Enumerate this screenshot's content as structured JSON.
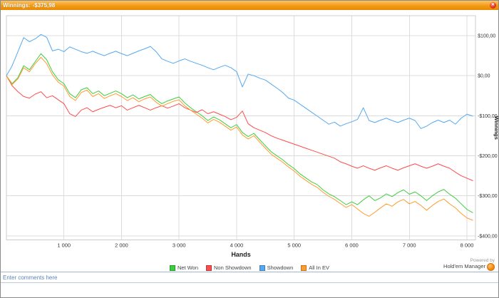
{
  "window": {
    "title_label": "Winnings:",
    "title_value": "-$375,98",
    "close_glyph": "✕"
  },
  "chart_data": {
    "type": "line",
    "title": "",
    "xlabel": "Hands",
    "ylabel": "Winnings",
    "xlim": [
      0,
      8150
    ],
    "ylim": [
      -410,
      150
    ],
    "grid": true,
    "legend_position": "bottom",
    "x_start": 0,
    "x_step": 100,
    "x_ticks": [
      1000,
      2000,
      3000,
      4000,
      5000,
      6000,
      7000,
      8000
    ],
    "x_tick_labels": [
      "1 000",
      "2 000",
      "3 000",
      "4 000",
      "5 000",
      "6 000",
      "7 000",
      "8 000"
    ],
    "y_ticks": [
      100,
      0,
      -100,
      -200,
      -300,
      -400
    ],
    "y_tick_labels": [
      "$100,00",
      "$0,00",
      "-$100,00",
      "-$200,00",
      "-$300,00",
      "-$400,00"
    ],
    "series": [
      {
        "name": "Net Won",
        "color": "#3ecc3e",
        "values": [
          0,
          -20,
          -5,
          25,
          15,
          35,
          55,
          40,
          10,
          -10,
          -20,
          -45,
          -55,
          -35,
          -30,
          -45,
          -38,
          -50,
          -44,
          -38,
          -45,
          -55,
          -48,
          -58,
          -52,
          -47,
          -60,
          -70,
          -63,
          -58,
          -53,
          -68,
          -80,
          -90,
          -100,
          -112,
          -103,
          -110,
          -120,
          -130,
          -122,
          -142,
          -152,
          -144,
          -160,
          -175,
          -190,
          -200,
          -210,
          -222,
          -232,
          -245,
          -255,
          -265,
          -272,
          -285,
          -295,
          -302,
          -312,
          -322,
          -315,
          -322,
          -310,
          -300,
          -312,
          -305,
          -295,
          -302,
          -292,
          -285,
          -296,
          -290,
          -300,
          -312,
          -300,
          -290,
          -284,
          -296,
          -306,
          -320,
          -334,
          -342
        ]
      },
      {
        "name": "Non Showdown",
        "color": "#ff4b4b",
        "values": [
          0,
          -25,
          -40,
          -52,
          -56,
          -46,
          -40,
          -55,
          -50,
          -60,
          -70,
          -95,
          -102,
          -86,
          -80,
          -90,
          -84,
          -79,
          -74,
          -80,
          -75,
          -86,
          -80,
          -74,
          -80,
          -86,
          -80,
          -75,
          -81,
          -76,
          -70,
          -80,
          -86,
          -92,
          -85,
          -95,
          -90,
          -96,
          -102,
          -110,
          -104,
          -88,
          -120,
          -130,
          -136,
          -142,
          -150,
          -156,
          -161,
          -166,
          -171,
          -176,
          -181,
          -186,
          -191,
          -196,
          -201,
          -206,
          -215,
          -220,
          -226,
          -231,
          -225,
          -231,
          -236,
          -230,
          -225,
          -231,
          -236,
          -230,
          -225,
          -220,
          -226,
          -231,
          -226,
          -220,
          -226,
          -231,
          -241,
          -250,
          -256,
          -262
        ]
      },
      {
        "name": "Showdown",
        "color": "#55a9f0",
        "values": [
          0,
          25,
          60,
          95,
          85,
          92,
          103,
          96,
          62,
          66,
          60,
          72,
          66,
          60,
          56,
          61,
          55,
          50,
          56,
          61,
          55,
          50,
          56,
          62,
          67,
          73,
          60,
          42,
          36,
          31,
          37,
          42,
          36,
          31,
          26,
          20,
          15,
          21,
          26,
          20,
          10,
          -28,
          4,
          0,
          -6,
          -11,
          -21,
          -31,
          -42,
          -56,
          -61,
          -71,
          -81,
          -91,
          -101,
          -111,
          -121,
          -116,
          -126,
          -120,
          -115,
          -109,
          -80,
          -112,
          -117,
          -111,
          -106,
          -112,
          -117,
          -111,
          -106,
          -112,
          -132,
          -126,
          -117,
          -111,
          -117,
          -111,
          -121,
          -106,
          -96,
          -101
        ]
      },
      {
        "name": "All In EV",
        "color": "#ff9b2e",
        "values": [
          0,
          -22,
          -8,
          20,
          10,
          30,
          46,
          30,
          2,
          -16,
          -26,
          -52,
          -62,
          -42,
          -36,
          -52,
          -45,
          -57,
          -50,
          -45,
          -52,
          -62,
          -55,
          -65,
          -58,
          -53,
          -66,
          -76,
          -70,
          -64,
          -60,
          -75,
          -86,
          -96,
          -106,
          -118,
          -109,
          -116,
          -126,
          -136,
          -128,
          -148,
          -158,
          -150,
          -166,
          -181,
          -196,
          -206,
          -216,
          -228,
          -238,
          -251,
          -261,
          -271,
          -279,
          -291,
          -301,
          -309,
          -319,
          -329,
          -322,
          -333,
          -344,
          -351,
          -341,
          -330,
          -320,
          -326,
          -315,
          -309,
          -320,
          -314,
          -324,
          -336,
          -324,
          -314,
          -308,
          -320,
          -330,
          -344,
          -355,
          -361
        ]
      }
    ]
  },
  "footer": {
    "powered_by": "Powered by",
    "brand": "Hold'em Manager",
    "comment_placeholder": "Enter comments here"
  }
}
